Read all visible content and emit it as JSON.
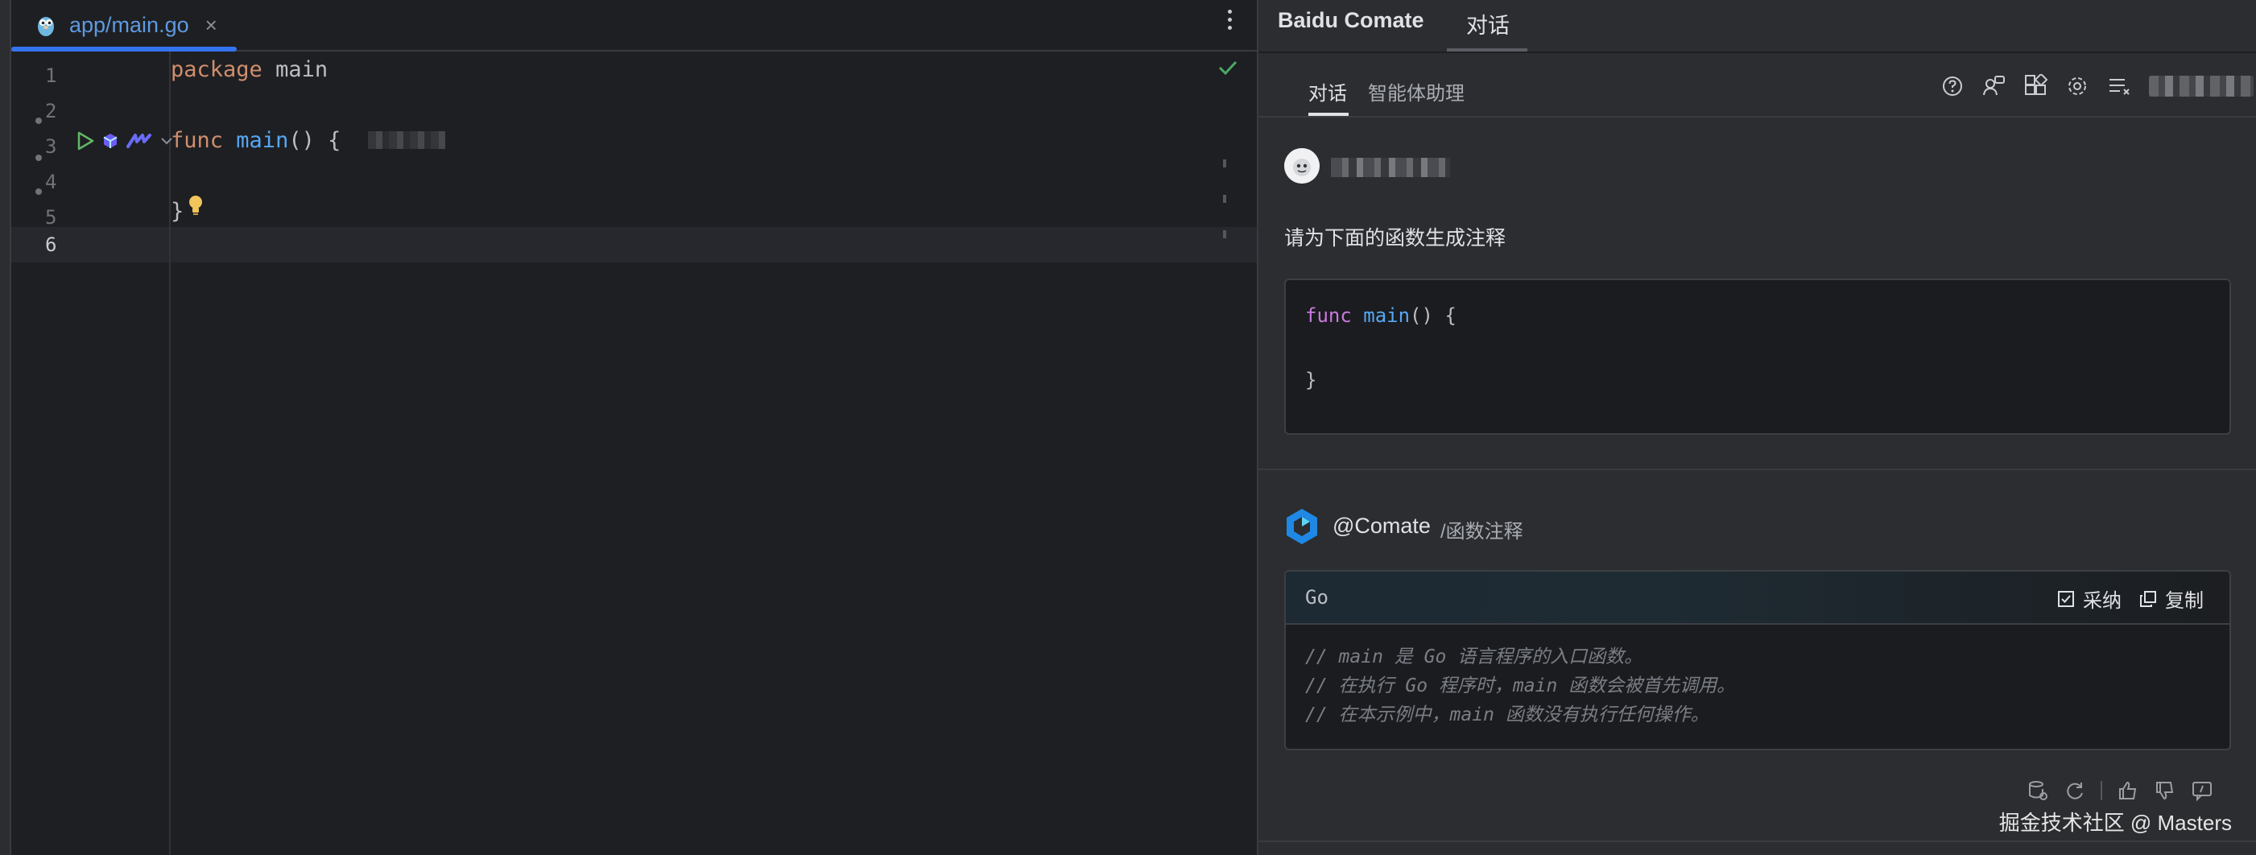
{
  "editor": {
    "tab": {
      "label": "app/main.go",
      "close": "×"
    },
    "line_numbers": [
      "1",
      "2",
      "3",
      "4",
      "5",
      "6"
    ],
    "code": {
      "l1_kw": "package",
      "l1_name": "main",
      "l3_kw": "func",
      "l3_fn": "main",
      "l3_rest": "() {",
      "l5": "}"
    }
  },
  "panel": {
    "title": "Baidu Comate",
    "top_tab": "对话",
    "sub_tabs": [
      "对话",
      "智能体助理"
    ],
    "prompt": "请为下面的函数生成注释",
    "user_code": {
      "kw": "func",
      "fn": "main",
      "rest": "() {",
      "close": "}"
    },
    "assistant": {
      "name": "@Comate",
      "command": "/函数注释"
    },
    "answer": {
      "lang": "Go",
      "accept": "采纳",
      "copy": "复制",
      "lines": [
        "// main 是 Go 语言程序的入口函数。",
        "// 在执行 Go 程序时，main 函数会被首先调用。",
        "// 在本示例中，main 函数没有执行任何操作。"
      ]
    },
    "watermark": "掘金技术社区 @ Masters"
  },
  "colors": {
    "accent": "#3574f0",
    "keyword": "#cf8e6d",
    "function": "#56a8f5",
    "success": "#4ca964",
    "bulb": "#f2c55c"
  }
}
